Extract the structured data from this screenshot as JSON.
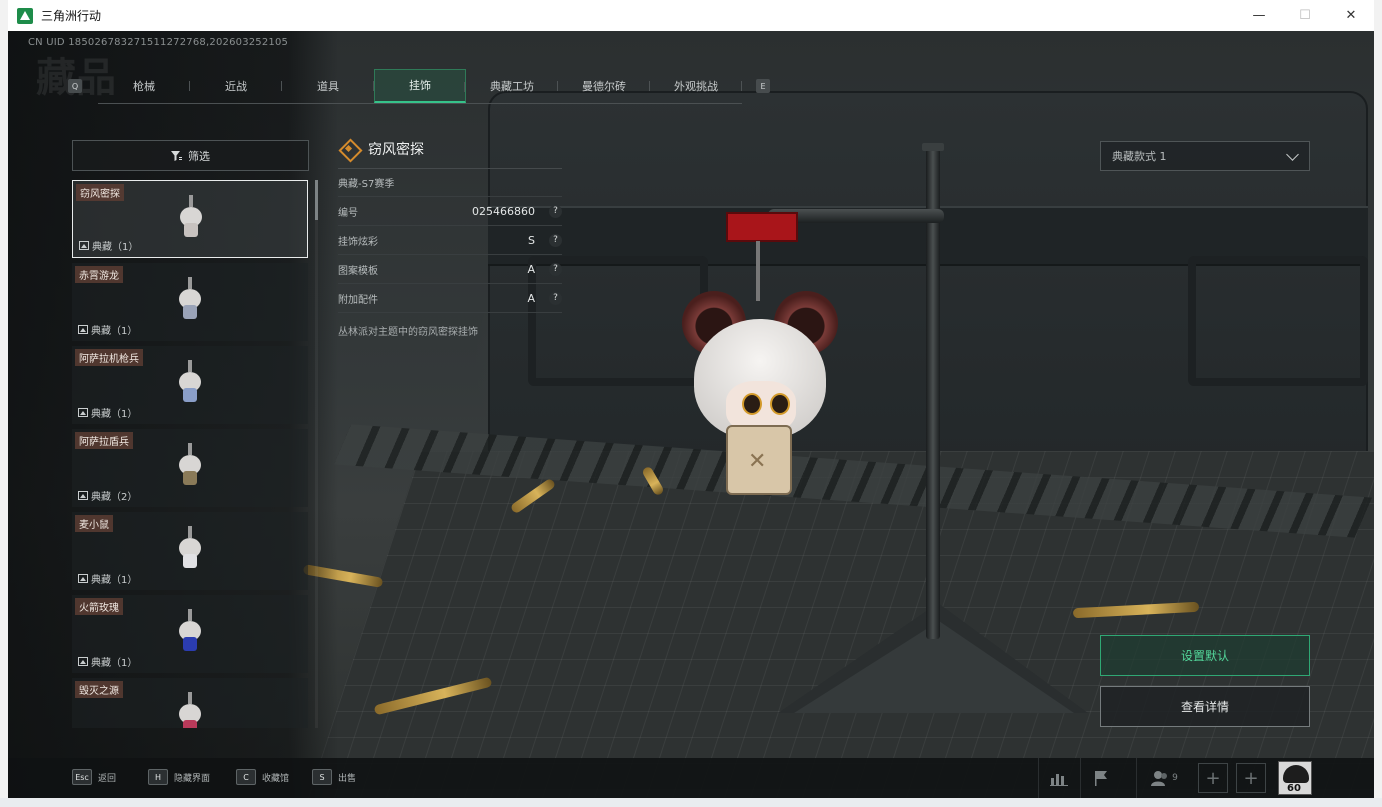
{
  "window": {
    "title": "三角洲行动",
    "controls": [
      "—",
      "☐",
      "✕"
    ]
  },
  "uid": "CN UID 1850267832715112727​68,202603252105",
  "nav": {
    "prev_key": "Q",
    "next_key": "E",
    "tabs": [
      "枪械",
      "近战",
      "道具",
      "挂饰",
      "典藏工坊",
      "曼德尔砖",
      "外观挑战"
    ],
    "active_tab": "挂饰"
  },
  "filter": {
    "label": "筛选",
    "icon": "filter-icon"
  },
  "items": [
    {
      "name": "窃风密探",
      "count": "典藏（1）",
      "color": "#c7c2bf"
    },
    {
      "name": "赤霄游龙",
      "count": "典藏（1）",
      "color": "#9aa3b8"
    },
    {
      "name": "阿萨拉机枪兵",
      "count": "典藏（1）",
      "color": "#8a9ec8"
    },
    {
      "name": "阿萨拉盾兵",
      "count": "典藏（2）",
      "color": "#8a7a58"
    },
    {
      "name": "麦小鼠",
      "count": "典藏（1）",
      "color": "#e1e1e4"
    },
    {
      "name": "火箭玫瑰",
      "count": "典藏（1）",
      "color": "#2b3cb0"
    },
    {
      "name": "毁灭之源",
      "count": "",
      "color": "#b83a5a"
    }
  ],
  "detail": {
    "title": "窃风密探",
    "season": "典藏-S7赛季",
    "attributes": [
      {
        "label": "编号",
        "value": "025466860"
      },
      {
        "label": "挂饰炫彩",
        "value": "S"
      },
      {
        "label": "图案模板",
        "value": "A"
      },
      {
        "label": "附加配件",
        "value": "A"
      }
    ],
    "description": "丛林派对主题中的窃风密探挂饰"
  },
  "style_select": {
    "value": "典藏款式 1"
  },
  "actions": {
    "set_default": "设置默认",
    "view_detail": "查看详情"
  },
  "bottom_hints": [
    {
      "key": "Esc",
      "label": "返回"
    },
    {
      "key": "H",
      "label": "隐藏界面"
    },
    {
      "key": "C",
      "label": "收藏馆"
    },
    {
      "key": "S",
      "label": "出售"
    }
  ],
  "bottom_right": {
    "friends_count": "9",
    "level": "60"
  },
  "colors": {
    "accent": "#36c28a",
    "title_orange": "#d58b2c"
  }
}
